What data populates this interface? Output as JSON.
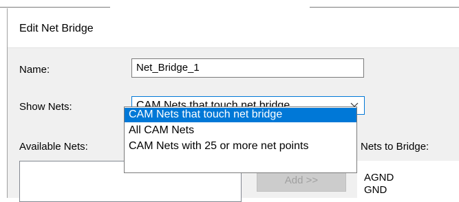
{
  "dialog": {
    "title": "Edit Net Bridge",
    "name_label": "Name:",
    "name_value": "Net_Bridge_1",
    "show_nets_label": "Show Nets:",
    "show_nets_selected": "CAM Nets that touch net bridge",
    "show_nets_options": [
      "CAM Nets that touch net bridge",
      "All CAM Nets",
      "CAM Nets with 25 or more net points"
    ],
    "available_nets_label": "Available Nets:",
    "nets_to_bridge_label": "Nets to Bridge:",
    "add_button": "Add >>",
    "nets_to_bridge": [
      "AGND",
      "GND"
    ]
  },
  "colors": {
    "accent": "#0078d7",
    "dialog_bg": "#f0f0f0",
    "disabled_text": "#a0a0a0"
  }
}
